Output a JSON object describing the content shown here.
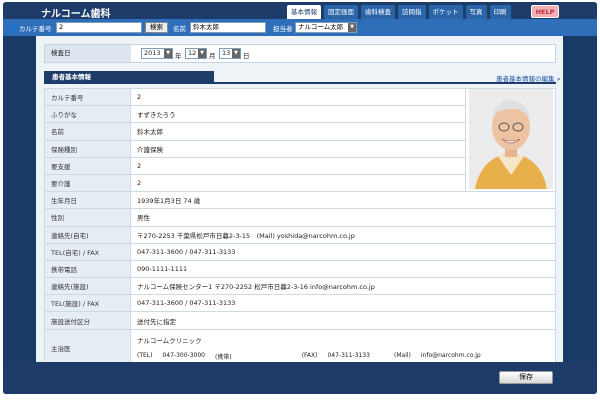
{
  "app": {
    "title": "ナルコーム歯科"
  },
  "tabs": [
    {
      "label": "基本情報",
      "active": true
    },
    {
      "label": "固定画面",
      "active": false
    },
    {
      "label": "歯科検査",
      "active": false
    },
    {
      "label": "訪問指",
      "active": false
    },
    {
      "label": "ポケット",
      "active": false
    },
    {
      "label": "写真",
      "active": false
    },
    {
      "label": "印刷",
      "active": false
    }
  ],
  "help_label": "HELP",
  "search": {
    "chart_label": "カルテ番号",
    "chart_value": "2",
    "search_button": "検索",
    "name_label": "名前",
    "name_value": "鈴木太郎",
    "staff_label": "担当者",
    "staff_value": "ナルコーム太郎"
  },
  "exam_date": {
    "label": "検査日",
    "year": "2013",
    "year_unit": "年",
    "month": "12",
    "month_unit": "月",
    "day": "13",
    "day_unit": "日"
  },
  "section": {
    "title": "患者基本情報",
    "edit_link": "患者基本情報の編集 »"
  },
  "patient_rows": [
    {
      "label": "カルテ番号",
      "value": "2"
    },
    {
      "label": "ふりがな",
      "value": "すずきたろう"
    },
    {
      "label": "名前",
      "value": "鈴木太郎"
    },
    {
      "label": "保険種別",
      "value": "介護保険"
    },
    {
      "label": "要支援",
      "value": "2"
    },
    {
      "label": "要介護",
      "value": "2"
    },
    {
      "label": "生年月日",
      "value": "1939年1月3日 74 歳"
    },
    {
      "label": "性別",
      "value": "男性"
    },
    {
      "label": "連絡先(自宅)",
      "value": "〒270-2253 千葉県松戸市日暮2-3-15　(Mail) yoshida@narcohm.co.jp"
    },
    {
      "label": "TEL(自宅) / FAX",
      "value": "047-311-3600 / 047-311-3133"
    },
    {
      "label": "携帯電話",
      "value": "090-1111-1111"
    },
    {
      "label": "連絡先(施設)",
      "value": "ナルコーム保険センター1 〒270-2252 松戸市日暮2-3-16 info@narcohm.co.jp"
    },
    {
      "label": "TEL(施設) / FAX",
      "value": "047-311-3600 / 047-311-3133"
    },
    {
      "label": "施設送付区分",
      "value": "送付先に指定"
    }
  ],
  "doctor": {
    "label": "主治医",
    "name": "ナルコームクリニック",
    "tel_label": "(TEL)",
    "tel": "047-300-3000",
    "mobile_label": "(携帯)",
    "fax_label": "(FAX)",
    "fax": "047-311-3133",
    "mail_label": "(Mail)",
    "mail": "info@narcohm.co.jp"
  },
  "footer": {
    "save_label": "保存"
  },
  "colors": {
    "header_bg": "#1d3c6a",
    "searchbar_bg": "#2f6fba",
    "tab_bg": "#2a65a8",
    "help_bg": "#f3b0b6"
  }
}
